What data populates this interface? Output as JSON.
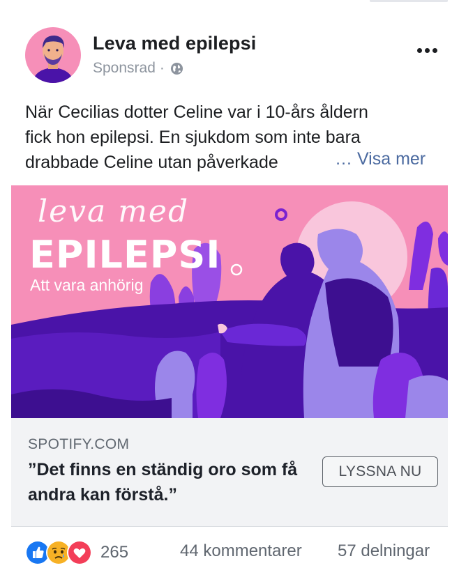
{
  "post": {
    "page_name": "Leva med epilepsi",
    "sponsored": "Sponsrad",
    "separator": "·",
    "privacy_icon": "globe-icon",
    "more_icon": "more-horizontal-icon",
    "text_lines": [
      "När Cecilias dotter Celine var i 10-års åldern",
      "fick hon epilepsi. En sjukdom som inte bara",
      "drabbade Celine utan påverkade"
    ],
    "see_more": "… Visa mer"
  },
  "hero": {
    "script_title": "leva med",
    "title": "EPILEPSI",
    "subtitle": "Att vara anhörig",
    "colors": {
      "background": "#f68fb8",
      "dark_purple": "#4a13a8",
      "mid_purple": "#6a28d6",
      "lavender": "#9b86ea",
      "pale_pink": "#f9c6dc"
    }
  },
  "link": {
    "domain": "SPOTIFY.COM",
    "headline": "”Det finns en ständig oro som få andra kan förstå.”",
    "cta": "LYSSNA NU"
  },
  "footer": {
    "reactions": [
      "like-icon",
      "sad-icon",
      "love-icon"
    ],
    "reaction_count": "265",
    "comments": "44 kommentarer",
    "shares": "57 delningar",
    "colors": {
      "like": "#1877f2",
      "sad": "#f7b125",
      "love": "#f33e58"
    }
  }
}
